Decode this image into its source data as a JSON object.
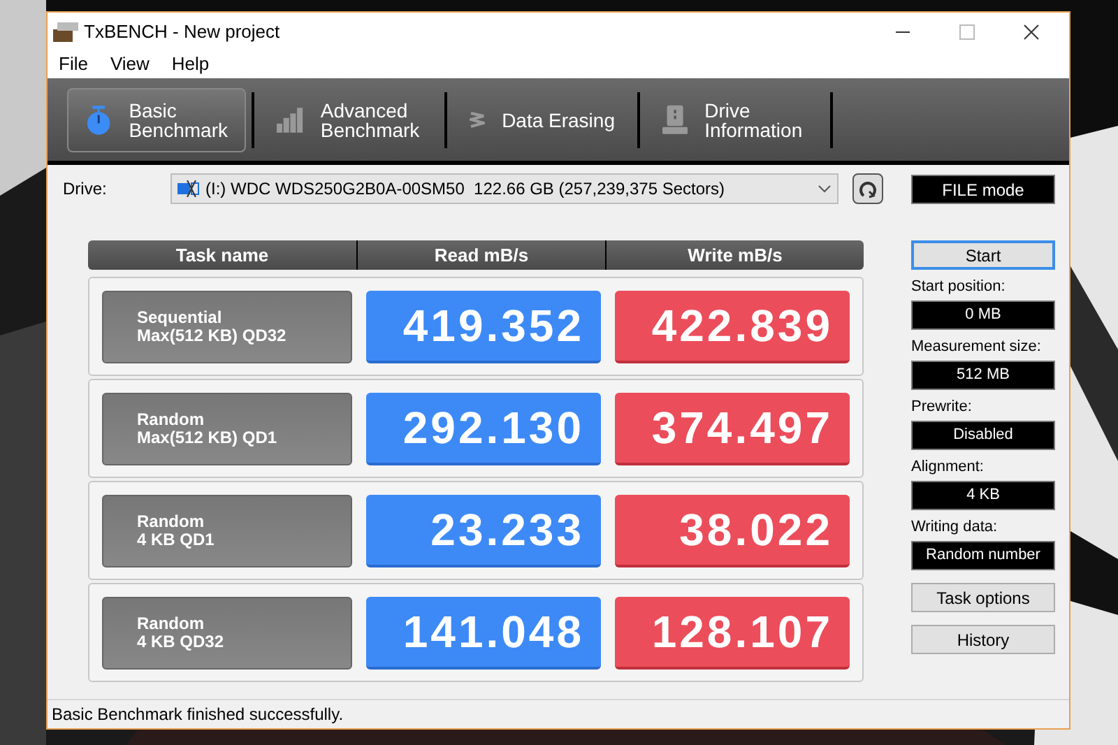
{
  "window": {
    "title": "TxBENCH - New project"
  },
  "menu": [
    "File",
    "View",
    "Help"
  ],
  "tabs": [
    {
      "label": "Basic Benchmark",
      "selected": true
    },
    {
      "label": "Advanced Benchmark",
      "selected": false
    },
    {
      "label": "Data Erasing",
      "selected": false
    },
    {
      "label": "Drive Information",
      "selected": false
    }
  ],
  "drive": {
    "label": "Drive:",
    "value": "(I:) WDC WDS250G2B0A-00SM50  122.66 GB (257,239,375 Sectors)"
  },
  "mode": "FILE mode",
  "table": {
    "columns": [
      "Task name",
      "Read mB/s",
      "Write mB/s"
    ],
    "rows": [
      {
        "task": [
          "Sequential",
          "Max(512 KB) QD32"
        ],
        "read": "419.352",
        "write": "422.839"
      },
      {
        "task": [
          "Random",
          "Max(512 KB) QD1"
        ],
        "read": "292.130",
        "write": "374.497"
      },
      {
        "task": [
          "Random",
          "4 KB QD1"
        ],
        "read": "23.233",
        "write": "38.022"
      },
      {
        "task": [
          "Random",
          "4 KB QD32"
        ],
        "read": "141.048",
        "write": "128.107"
      }
    ]
  },
  "side": {
    "start": "Start",
    "settings": [
      {
        "label": "Start position:",
        "value": "0 MB"
      },
      {
        "label": "Measurement size:",
        "value": "512 MB"
      },
      {
        "label": "Prewrite:",
        "value": "Disabled"
      },
      {
        "label": "Alignment:",
        "value": "4 KB"
      },
      {
        "label": "Writing data:",
        "value": "Random number"
      }
    ],
    "buttons": [
      "Task options",
      "History"
    ]
  },
  "status_bar": "Basic Benchmark finished successfully."
}
